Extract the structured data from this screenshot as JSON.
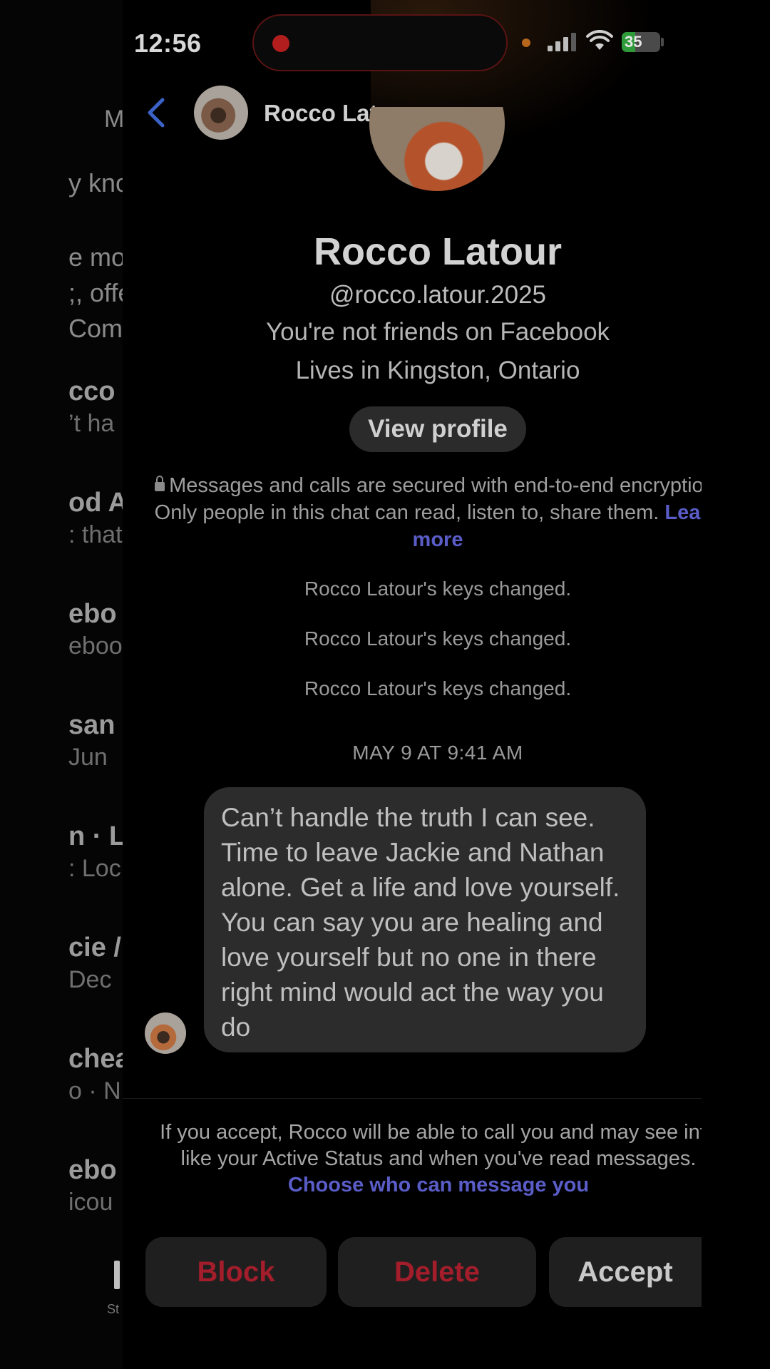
{
  "status_bar": {
    "time": "12:56",
    "battery": "35",
    "battery_fraction": 0.35
  },
  "background_list": {
    "title": "M",
    "rows": [
      {
        "name": "",
        "subtitle": "y kno"
      },
      {
        "name": "e mo",
        "subtitle": ";, offe"
      },
      {
        "name": "",
        "subtitle": "Comr"
      },
      {
        "name": "cco L",
        "subtitle": "’t ha"
      },
      {
        "name": "od A",
        "subtitle": ": that"
      },
      {
        "name": "ebo",
        "subtitle": "eboo"
      },
      {
        "name": "san E",
        "subtitle": "Jun"
      },
      {
        "name": "n · L",
        "subtitle": ": Loc"
      },
      {
        "name": "cie /",
        "subtitle": "Dec"
      },
      {
        "name": "chea",
        "subtitle": "o · N"
      },
      {
        "name": "ebo",
        "subtitle": "icou"
      }
    ],
    "stories_label": "St"
  },
  "header": {
    "name": "Rocco Latour"
  },
  "profile": {
    "name": "Rocco Latour",
    "handle": "@rocco.latour.2025",
    "friends_status": "You're not friends on Facebook",
    "location": "Lives in Kingston, Ontario",
    "view_profile_label": "View profile"
  },
  "encryption": {
    "text": "Messages and calls are secured with end-to-end encryption. Only people in this chat can read, listen to, share them.",
    "link": "Learn more"
  },
  "system_messages": [
    "Rocco Latour's keys changed.",
    "Rocco Latour's keys changed.",
    "Rocco Latour's keys changed."
  ],
  "date_separator": "MAY 9 AT 9:41 AM",
  "message": {
    "text": "Can’t handle the truth I can see.     Time to leave Jackie and Nathan alone.     Get a life and love yourself.     You can say you are healing and love yourself but no one in there right mind would act the way you do"
  },
  "request_info": {
    "text": "If you accept, Rocco will be able to call you and may see info like your Active Status and when you've read messages.",
    "link": "Choose who can message you"
  },
  "actions": {
    "block": "Block",
    "delete": "Delete",
    "accept": "Accept"
  }
}
